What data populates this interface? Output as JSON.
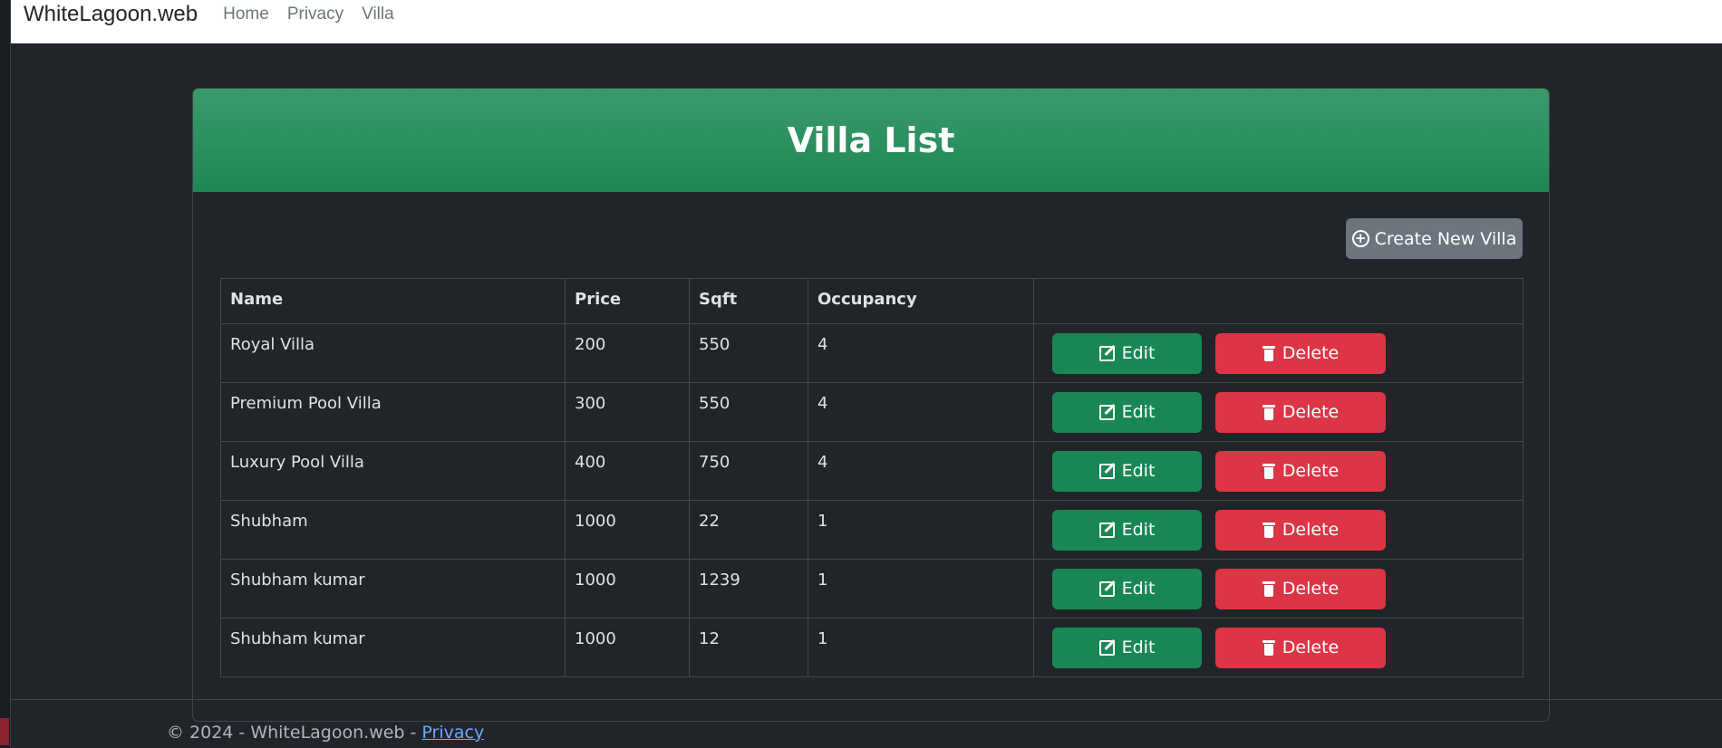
{
  "navbar": {
    "brand": "WhiteLagoon.web",
    "links": [
      "Home",
      "Privacy",
      "Villa"
    ]
  },
  "page": {
    "title": "Villa List",
    "create_label": "Create New Villa"
  },
  "table": {
    "headers": [
      "Name",
      "Price",
      "Sqft",
      "Occupancy",
      ""
    ],
    "rows": [
      {
        "name": "Royal Villa",
        "price": "200",
        "sqft": "550",
        "occupancy": "4"
      },
      {
        "name": "Premium Pool Villa",
        "price": "300",
        "sqft": "550",
        "occupancy": "4"
      },
      {
        "name": "Luxury Pool Villa",
        "price": "400",
        "sqft": "750",
        "occupancy": "4"
      },
      {
        "name": "Shubham",
        "price": "1000",
        "sqft": "22",
        "occupancy": "1"
      },
      {
        "name": "Shubham kumar",
        "price": "1000",
        "sqft": "1239",
        "occupancy": "1"
      },
      {
        "name": "Shubham kumar",
        "price": "1000",
        "sqft": "12",
        "occupancy": "1"
      }
    ],
    "edit_label": "Edit",
    "delete_label": "Delete"
  },
  "footer": {
    "text": "© 2024 - WhiteLagoon.web - ",
    "link": "Privacy"
  },
  "colors": {
    "background": "#212529",
    "header_green": "#198754",
    "edit_button": "#198754",
    "delete_button": "#dc3545",
    "create_button": "#6c757d"
  }
}
